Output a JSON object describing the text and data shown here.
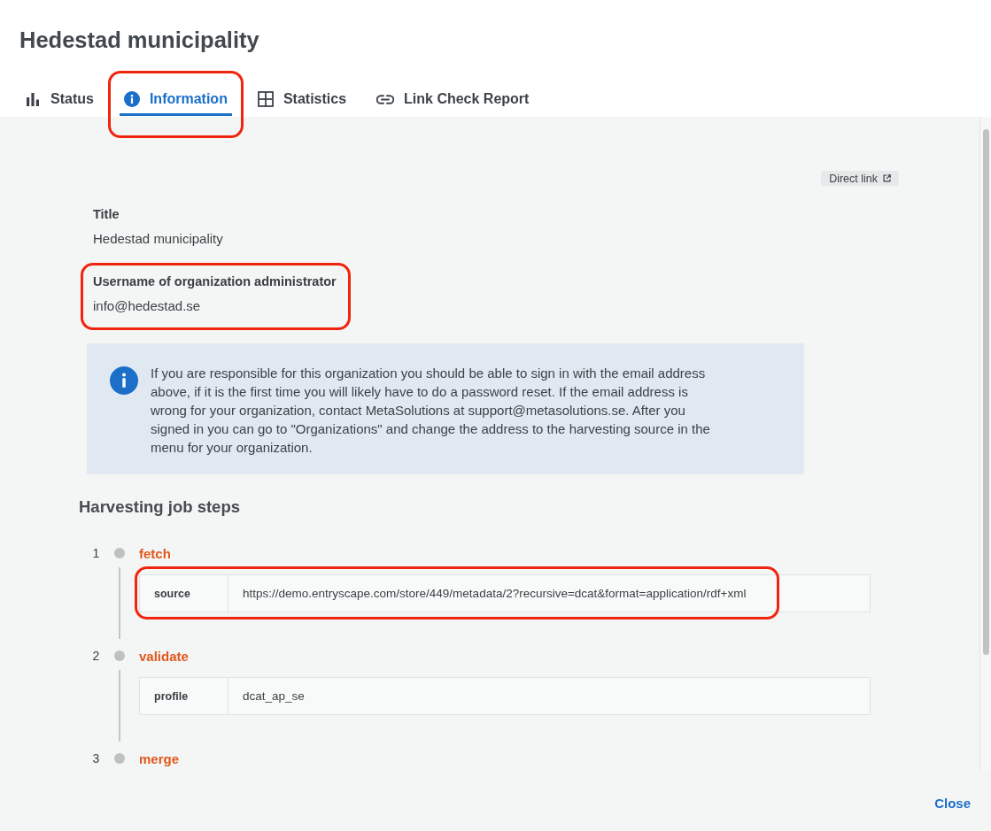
{
  "dialog": {
    "title": "Hedestad municipality"
  },
  "tabs": [
    {
      "label": "Status",
      "kind": "status",
      "selected": false,
      "highlighted": false
    },
    {
      "label": "Information",
      "kind": "info",
      "selected": true,
      "highlighted": true
    },
    {
      "label": "Statistics",
      "kind": "statistics",
      "selected": false,
      "highlighted": false
    },
    {
      "label": "Link Check Report",
      "kind": "links",
      "selected": false,
      "highlighted": false
    }
  ],
  "direct_link": {
    "label": "Direct link"
  },
  "fields": [
    {
      "label": "Title",
      "value": "Hedestad municipality",
      "highlighted": false
    },
    {
      "label": "Username of organization administrator",
      "value": "info@hedestad.se",
      "highlighted": true
    }
  ],
  "notice": {
    "text": "If you are responsible for this organization you should be able to sign in with the email address above, if it is the first time you will likely have to do a password reset. If the email address is wrong for your organization, contact MetaSolutions at support@metasolutions.se. After you signed in you can go to \"Organizations\" and change the address to the harvesting source in the menu for your organization."
  },
  "job_steps": {
    "heading": "Harvesting job steps",
    "steps": [
      {
        "number": "1",
        "name": "fetch",
        "params": [
          {
            "key": "source",
            "value": "https://demo.entryscape.com/store/449/metadata/2?recursive=dcat&format=application/rdf+xml",
            "highlighted": true
          }
        ]
      },
      {
        "number": "2",
        "name": "validate",
        "params": [
          {
            "key": "profile",
            "value": "dcat_ap_se",
            "highlighted": false
          }
        ]
      },
      {
        "number": "3",
        "name": "merge"
      }
    ]
  },
  "footer": {
    "close_label": "Close"
  }
}
